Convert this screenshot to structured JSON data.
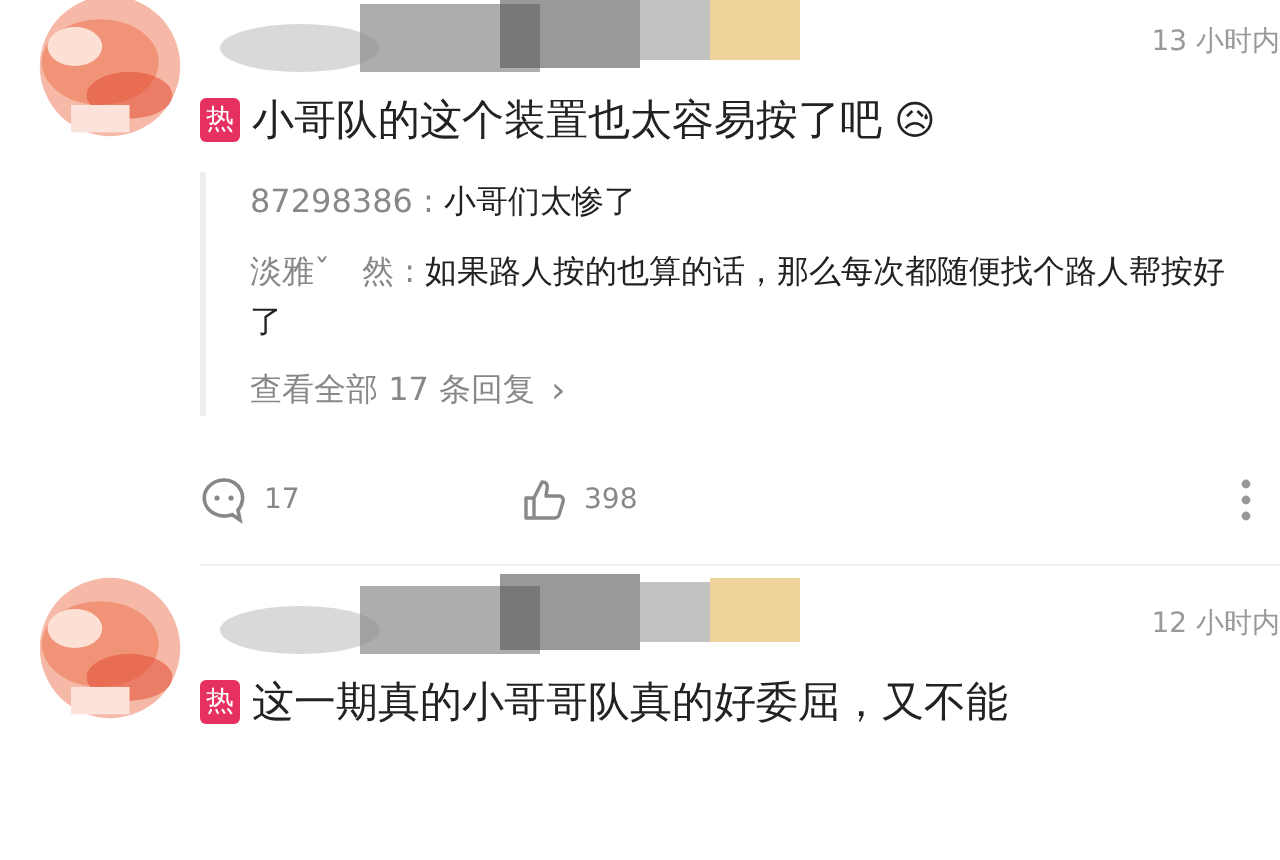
{
  "comments": [
    {
      "time": "13 小时内",
      "hot_badge": "热",
      "text": "小哥队的这个装置也太容易按了吧",
      "emoji": "😥",
      "replies": [
        {
          "user": "87298386",
          "separator": " : ",
          "text": "小哥们太惨了"
        },
        {
          "user": "淡雅ˇ　然",
          "separator": " : ",
          "text": "如果路人按的也算的话，那么每次都随便找个路人帮按好了"
        }
      ],
      "more_replies": "查看全部 17 条回复",
      "more_replies_arrow": "›",
      "comment_count": "17",
      "like_count": "398"
    },
    {
      "time": "12 小时内",
      "hot_badge": "热",
      "text": "这一期真的小哥哥队真的好委屈，又不能"
    }
  ]
}
